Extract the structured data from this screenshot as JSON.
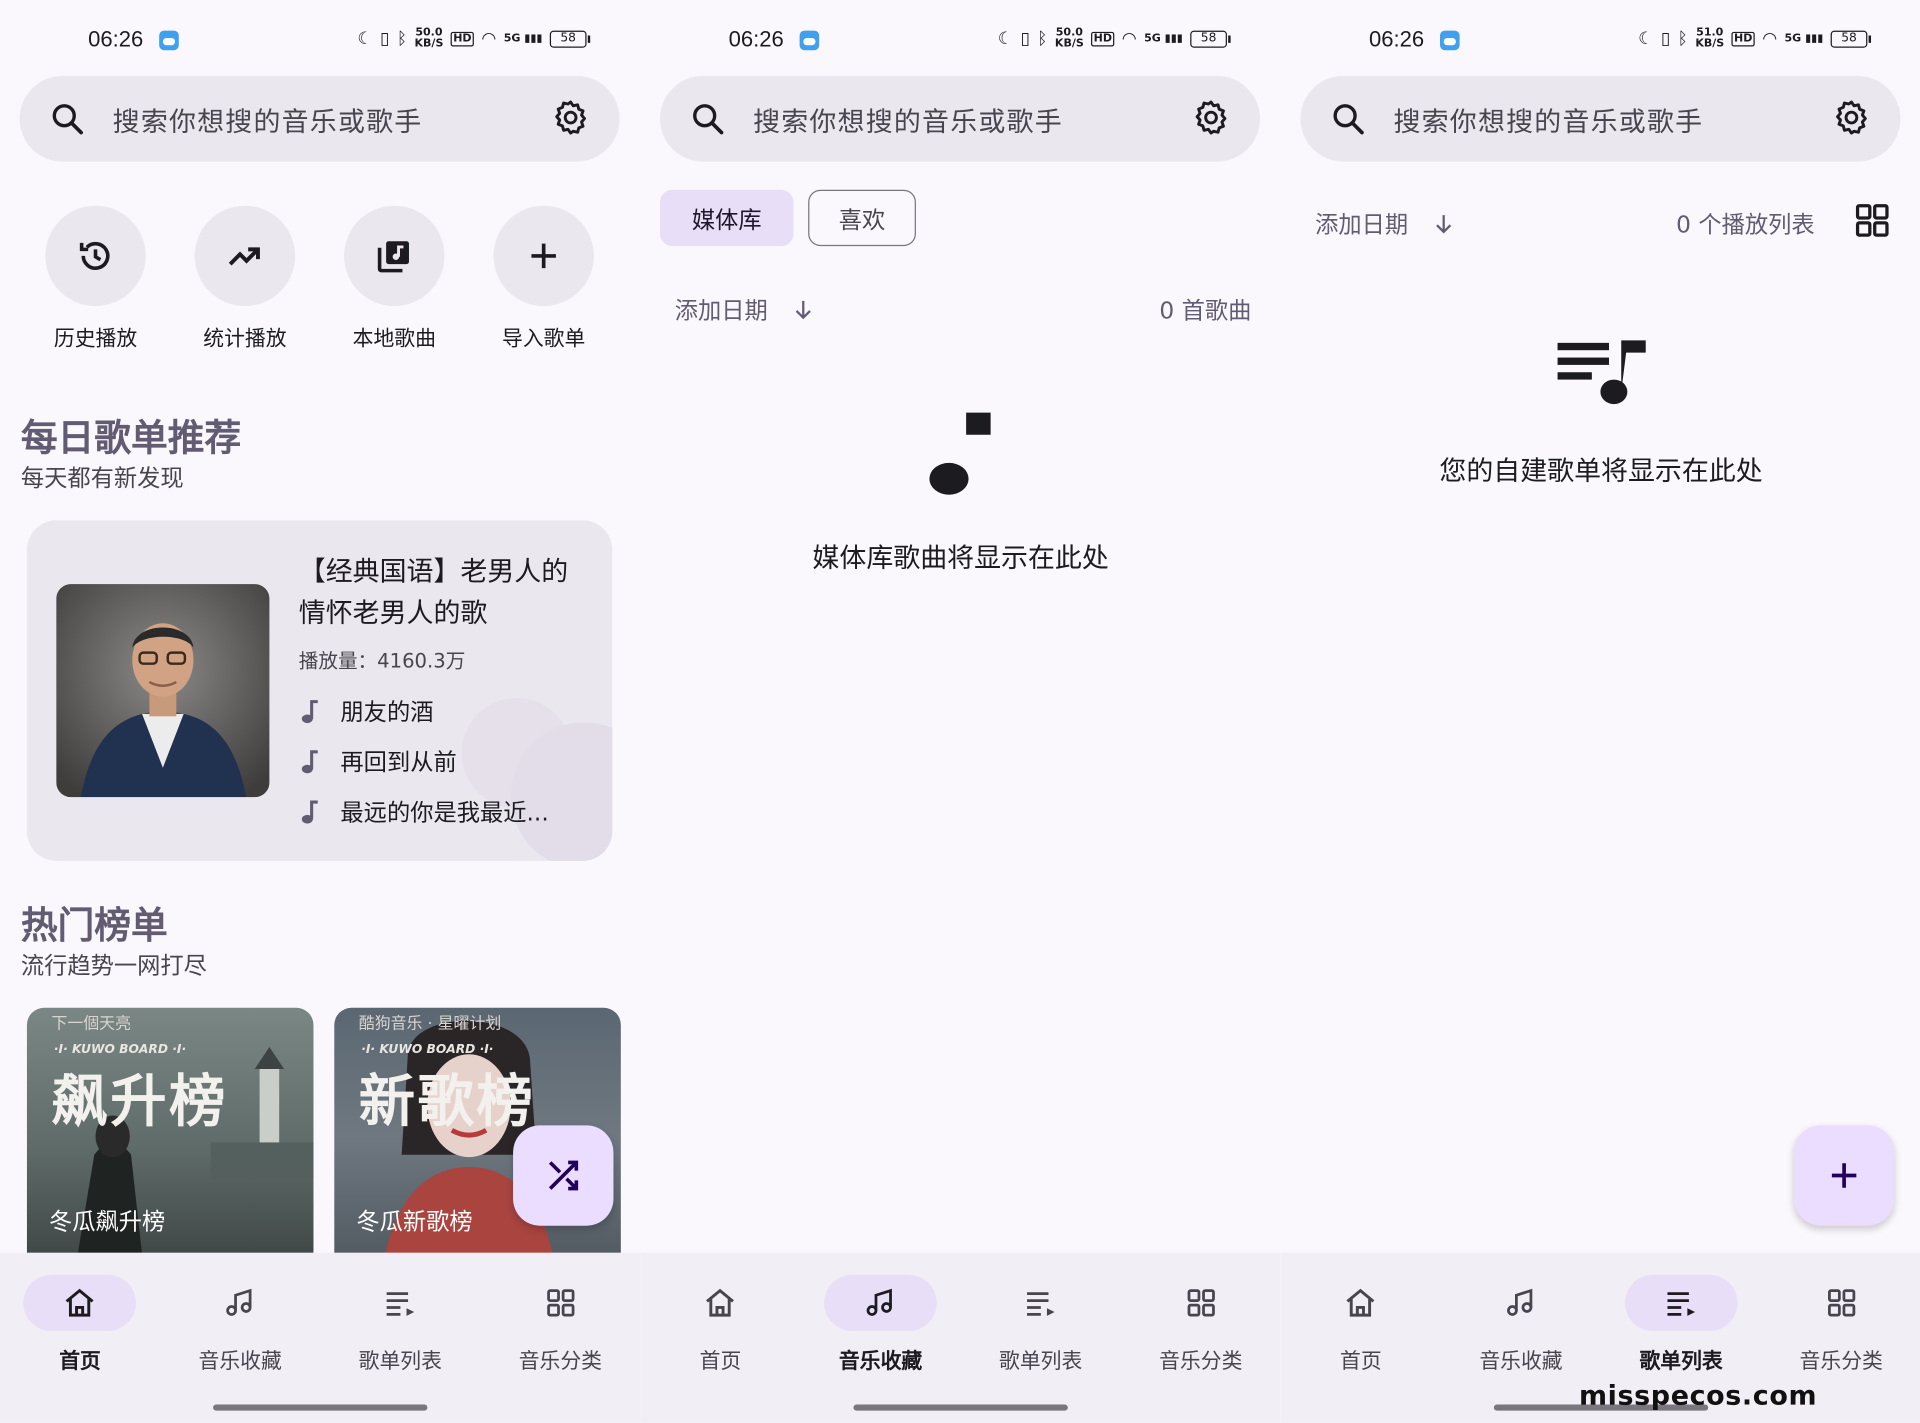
{
  "status": {
    "time": "06:26",
    "battery": "58",
    "net_1": "50.0",
    "net_2": "51.0",
    "net_unit": "KB/S",
    "hd": "HD",
    "signal_tag": "5G"
  },
  "search": {
    "placeholder": "搜索你想搜的音乐或歌手"
  },
  "home": {
    "quick": [
      {
        "label": "历史播放"
      },
      {
        "label": "统计播放"
      },
      {
        "label": "本地歌曲"
      },
      {
        "label": "导入歌单"
      }
    ],
    "daily": {
      "title": "每日歌单推荐",
      "subtitle": "每天都有新发现"
    },
    "card": {
      "title": "【经典国语】老男人的情怀老男人的歌",
      "plays": "播放量：4160.3万",
      "songs": [
        "朋友的酒",
        "再回到从前",
        "最远的你是我最近..."
      ]
    },
    "hot": {
      "title": "热门榜单",
      "subtitle": "流行趋势一网打尽"
    },
    "charts": [
      {
        "big": "飙升榜",
        "small": "下一個天亮",
        "kb": "·I· KUWO BOARD ·I·",
        "name": "冬瓜飙升榜"
      },
      {
        "big": "新歌榜",
        "small": "酷狗音乐 · 星曜计划",
        "kb": "·I· KUWO BOARD ·I·",
        "name": "冬瓜新歌榜"
      }
    ]
  },
  "library": {
    "chips": [
      "媒体库",
      "喜欢"
    ],
    "sort": "添加日期",
    "count": "0 首歌曲",
    "empty": "媒体库歌曲将显示在此处"
  },
  "playlists": {
    "sort": "添加日期",
    "count": "0 个播放列表",
    "empty": "您的自建歌单将显示在此处"
  },
  "nav": [
    "首页",
    "音乐收藏",
    "歌单列表",
    "音乐分类"
  ],
  "watermark": "misspecos.com"
}
